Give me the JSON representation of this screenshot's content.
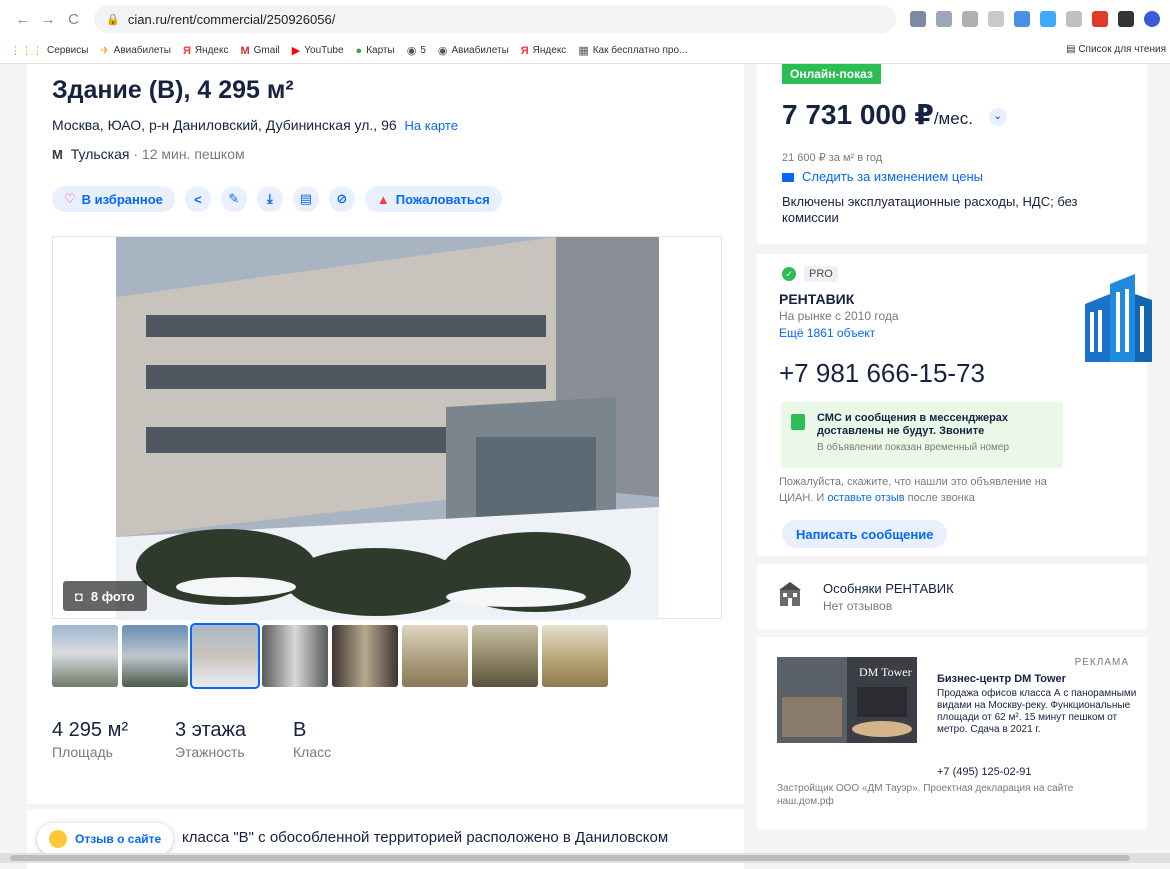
{
  "browser": {
    "url": "cian.ru/rent/commercial/250926056/",
    "bookmarks": [
      "Сервисы",
      "Авиабилеты",
      "Яндекс",
      "Gmail",
      "YouTube",
      "Карты",
      "5",
      "Авиабилеты",
      "Яндекс",
      "Как бесплатно про..."
    ],
    "reading_list": "Список для чтения"
  },
  "listing": {
    "title": "Здание (В), 4 295 м²",
    "address": "Москва, ЮАО, р-н Даниловский, Дубининская ул., 96",
    "map_link": "На карте",
    "metro_icon": "М",
    "metro": "Тульская",
    "metro_time": "· 12 мин. пешком",
    "favorite_label": "В избранное",
    "report_label": "Пожаловаться",
    "photo_count": "8 фото",
    "facts": [
      {
        "value": "4 295 м²",
        "label": "Площадь"
      },
      {
        "value": "3 этажа",
        "label": "Этажность"
      },
      {
        "value": "B",
        "label": "Класс"
      }
    ],
    "description_start": "класса \"В\" с обособленной территорией расположено в Даниловском"
  },
  "feedback_label": "Отзыв о сайте",
  "price": {
    "badge": "Онлайн-показ",
    "amount": "7 731 000 ₽",
    "per": "/мес.",
    "per_sqm": "21 600 ₽ за м² в год",
    "track": "Следить за изменением цены",
    "included": "Включены эксплуатационные расходы, НДС; без комиссии"
  },
  "agent": {
    "pro": "PRO",
    "name": "РЕНТАВИК",
    "since": "На рынке с 2010 года",
    "more": "Ещё 1861 объект",
    "phone": "+7 981 666-15-73",
    "sms_title": "СМС и сообщения в мессенджерах доставлены не будут. Звоните",
    "sms_note": "В объявлении показан временный номер",
    "tell_1": "Пожалуйста, скажите, что нашли это объявление на ЦИАН. И ",
    "tell_link": "оставьте отзыв",
    "tell_2": " после звонка",
    "write": "Написать сообщение"
  },
  "reviews": {
    "name": "Особняки РЕНТАВИК",
    "sub": "Нет отзывов"
  },
  "ad": {
    "label": "РЕКЛАМА",
    "img_text": "DM Tower",
    "title": "Бизнес-центр DM Tower",
    "text": "Продажа офисов класса А с панорамными видами на Москву-реку. Функциональные площади от 62 м². 15 минут пешком от метро. Сдача в 2021 г.",
    "phone": "+7 (495) 125-02-91",
    "foot": "Застройщик ООО «ДМ Тауэр». Проектная декларация на сайте наш.дом.рф"
  },
  "colors": {
    "accent": "#0468ff",
    "green": "#2dbd55",
    "text": "#152242"
  }
}
